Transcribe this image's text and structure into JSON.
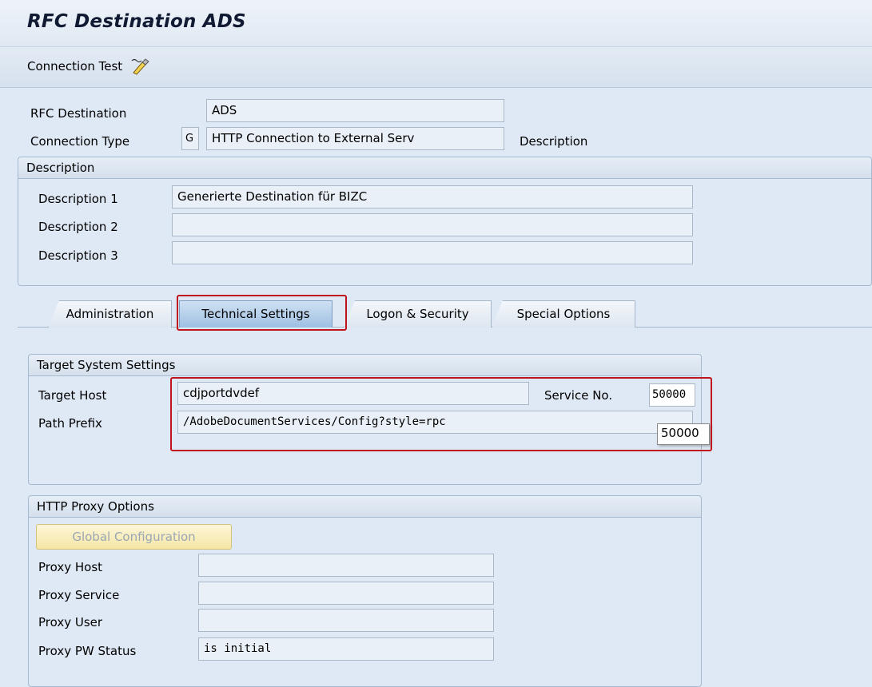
{
  "window": {
    "title": "RFC Destination ADS"
  },
  "toolbar": {
    "connection_test_label": "Connection Test"
  },
  "header": {
    "rfc_destination_label": "RFC Destination",
    "rfc_destination_value": "ADS",
    "connection_type_label": "Connection Type",
    "connection_type_code": "G",
    "connection_type_value": "HTTP Connection to External Serv",
    "description_label": "Description"
  },
  "description_group": {
    "title": "Description",
    "rows": [
      {
        "label": "Description 1",
        "value": "Generierte Destination für BIZC"
      },
      {
        "label": "Description 2",
        "value": ""
      },
      {
        "label": "Description 3",
        "value": ""
      }
    ]
  },
  "tabs": [
    {
      "label": "Administration"
    },
    {
      "label": "Technical Settings",
      "active": true
    },
    {
      "label": "Logon & Security"
    },
    {
      "label": "Special Options"
    }
  ],
  "target_system": {
    "title": "Target System Settings",
    "target_host_label": "Target Host",
    "target_host_value": "cdjportdvdef",
    "service_no_label": "Service No.",
    "service_no_value": "50000",
    "service_no_tooltip": "50000",
    "path_prefix_label": "Path Prefix",
    "path_prefix_value": "/AdobeDocumentServices/Config?style=rpc"
  },
  "proxy": {
    "title": "HTTP Proxy Options",
    "global_config_label": "Global Configuration",
    "rows": [
      {
        "label": "Proxy Host",
        "value": ""
      },
      {
        "label": "Proxy Service",
        "value": ""
      },
      {
        "label": "Proxy User",
        "value": ""
      },
      {
        "label": "Proxy PW Status",
        "value": "is initial"
      }
    ]
  },
  "colors": {
    "highlight": "#c0131b",
    "background": "#dfe9f5"
  }
}
